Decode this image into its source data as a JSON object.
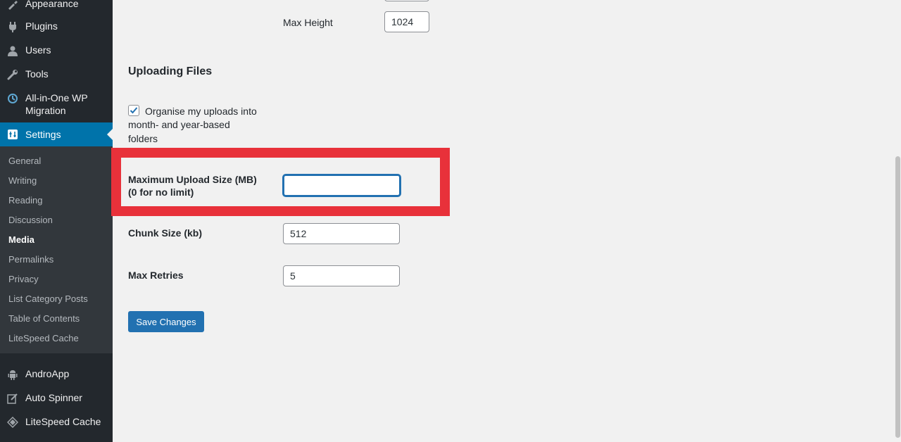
{
  "sidebar": {
    "items": [
      {
        "label": "Appearance",
        "icon": "brush-icon"
      },
      {
        "label": "Plugins",
        "icon": "plugin-icon"
      },
      {
        "label": "Users",
        "icon": "user-icon"
      },
      {
        "label": "Tools",
        "icon": "wrench-icon"
      },
      {
        "label": "All-in-One WP Migration",
        "icon": "migration-icon"
      },
      {
        "label": "Settings",
        "icon": "settings-icon"
      }
    ],
    "submenu": [
      "General",
      "Writing",
      "Reading",
      "Discussion",
      "Media",
      "Permalinks",
      "Privacy",
      "List Category Posts",
      "Table of Contents",
      "LiteSpeed Cache"
    ],
    "lower_items": [
      {
        "label": "AndroApp",
        "icon": "android-icon"
      },
      {
        "label": "Auto Spinner",
        "icon": "edit-icon"
      },
      {
        "label": "LiteSpeed Cache",
        "icon": "diamond-icon"
      }
    ]
  },
  "media": {
    "max_height_label": "Max Height",
    "max_height_value": "1024"
  },
  "uploading": {
    "title": "Uploading Files",
    "organise_checked": true,
    "organise_label_lines": [
      "Organise my uploads into",
      "month- and year-based",
      "folders"
    ],
    "max_upload_label_lines": [
      "Maximum Upload Size (MB)",
      "(0 for no limit)"
    ],
    "max_upload_value": "",
    "chunk_label": "Chunk Size (kb)",
    "chunk_value": "512",
    "retries_label": "Max Retries",
    "retries_value": "5"
  },
  "save_label": "Save Changes",
  "colors": {
    "highlight": "#e8313a",
    "accent": "#2271b1",
    "sidebar_bg": "#23282d",
    "active_menu": "#0073aa"
  }
}
